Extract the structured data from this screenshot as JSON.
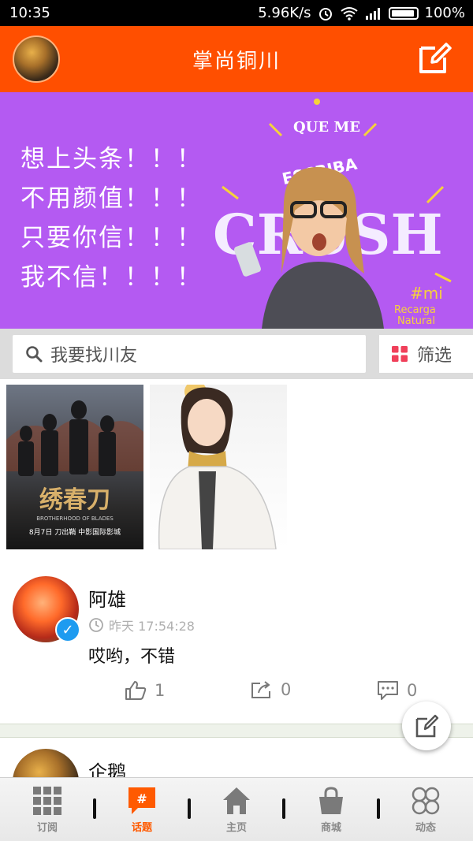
{
  "status_bar": {
    "time": "10:35",
    "speed": "5.96K/s",
    "battery": "100%"
  },
  "header": {
    "title": "掌尚铜川"
  },
  "banner": {
    "lines": [
      "想上头条！！！",
      "不用颜值！！！",
      "只要你信！！！",
      "我不信！！！！"
    ],
    "art_text": {
      "top": "QUE ME",
      "mid": "ESCRIBA",
      "big": "CRUSH",
      "tag1": "#mi",
      "tag2": "Recarga",
      "tag3": "Natural"
    }
  },
  "search": {
    "placeholder": "我要找川友"
  },
  "filter": {
    "label": "筛选"
  },
  "gallery": {
    "poster_title": "绣春刀",
    "poster_subtitle": "BROTHERHOOD OF BLADES",
    "poster_date": "8月7日 刀出鞘 中影国际影城"
  },
  "post": {
    "author": "阿雄",
    "time": "昨天 17:54:28",
    "text": "哎哟，不错",
    "likes": "1",
    "shares": "0",
    "comments": "0"
  },
  "post2": {
    "author": "企鹅"
  },
  "bottom_nav": [
    {
      "label": "订阅"
    },
    {
      "label": "话题"
    },
    {
      "label": "主页"
    },
    {
      "label": "商城"
    },
    {
      "label": "动态"
    }
  ],
  "colors": {
    "brand": "#ff4f00",
    "banner_bg": "#b45af2",
    "verified": "#1e9bf0",
    "filter_icon": "#f0405a"
  }
}
